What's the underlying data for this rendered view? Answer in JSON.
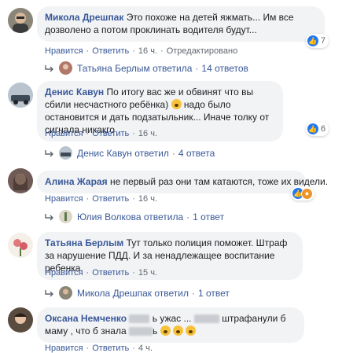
{
  "comments": [
    {
      "author": "Микола Дрешпак",
      "text": "Это похоже на детей яжмать... Им все дозволено а потом проклинать водителя будут...",
      "reactions_count": "7",
      "actions": {
        "like": "Нравится",
        "reply": "Ответить",
        "time": "16 ч.",
        "edited": "Отредактировано"
      },
      "replies": {
        "name": "Татьяна Берлым",
        "verb": "ответила",
        "count": "14 ответов"
      }
    },
    {
      "author": "Денис Кавун",
      "text_a": "По итогу вас же и обвинят что вы сбили несчастного ребёнка)",
      "text_b": "надо было остановится и дать подзатыльник... Иначе толку от сигнала никакго",
      "reactions_count": "6",
      "actions": {
        "like": "Нравится",
        "reply": "Ответить",
        "time": "16 ч."
      },
      "replies": {
        "name": "Денис Кавун",
        "verb": "ответил",
        "count": "4 ответа"
      }
    },
    {
      "author": "Алина Жарая",
      "text": "не первый раз они там катаются, тоже их видели.",
      "reactions_count": "",
      "actions": {
        "like": "Нравится",
        "reply": "Ответить",
        "time": "16 ч."
      },
      "replies": {
        "name": "Юлия Волкова",
        "verb": "ответила",
        "count": "1 ответ"
      }
    },
    {
      "author": "Татьяна Берлым",
      "text": "Тут только полиция поможет. Штраф за нарушение ПДД. И за ненадлежащее воспитание ребенка.",
      "actions": {
        "like": "Нравится",
        "reply": "Ответить",
        "time": "15 ч."
      },
      "replies": {
        "name": "Микола Дрешпак",
        "verb": "ответил",
        "count": "1 ответ"
      }
    },
    {
      "author": "Оксана Немченко",
      "text_a": "ь ужас ...",
      "text_b": "штрафанули б маму , что б знала",
      "text_c": "ь",
      "actions": {
        "like": "Нравится",
        "reply": "Ответить",
        "time": "4 ч."
      }
    }
  ],
  "separator": "·",
  "colors": {
    "link": "#385898",
    "bubble": "#f2f3f5",
    "like": "#2078f4",
    "meta": "#606770"
  },
  "icons": {
    "like": "thumbs-up-icon",
    "angry": "angry-reaction-icon",
    "reply": "reply-arrow-icon"
  }
}
